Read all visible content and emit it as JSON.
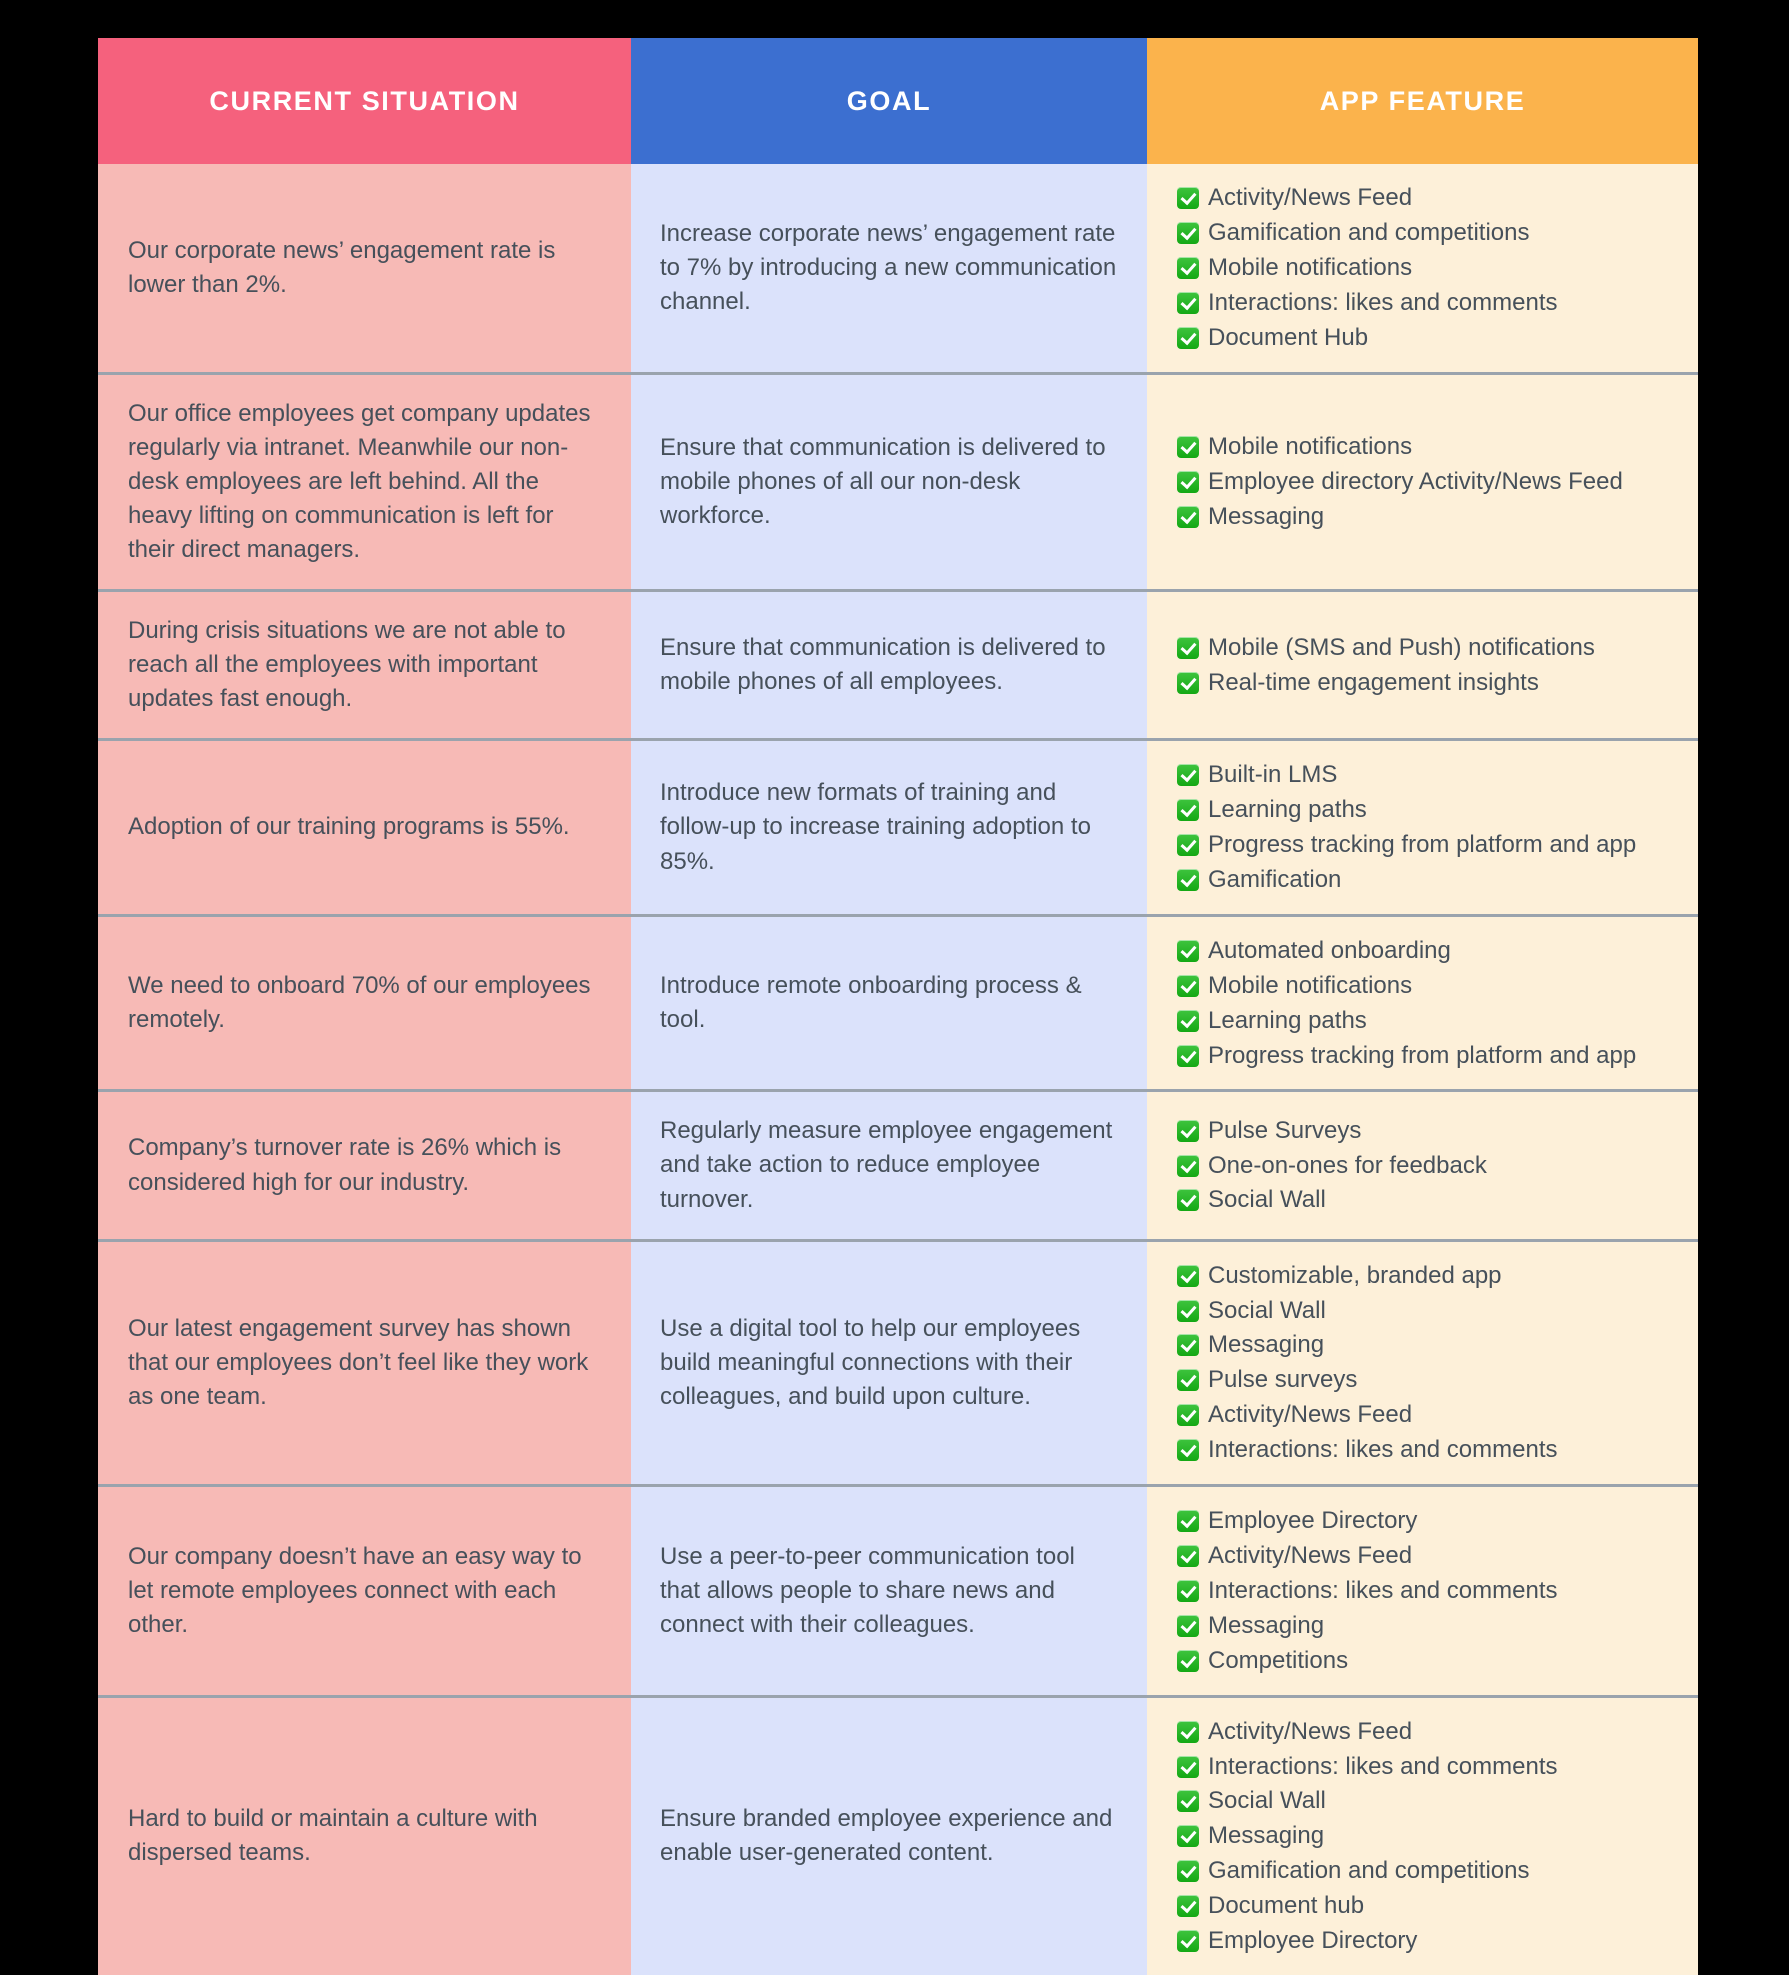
{
  "header": {
    "columns": [
      {
        "label": "CURRENT SITUATION",
        "color": "#f5617d"
      },
      {
        "label": "GOAL",
        "color": "#3c6fd0"
      },
      {
        "label": "APP FEATURE",
        "color": "#fbb34c"
      }
    ]
  },
  "colors": {
    "header_situation": "#f5617d",
    "header_goal": "#3c6fd0",
    "header_feature": "#fbb34c",
    "cell_situation": "#f7bab6",
    "cell_goal": "#dbe2fb",
    "cell_feature": "#fdf0d9",
    "text": "#46505a",
    "check_green": "#14a814",
    "divider": "#9aa3ad",
    "page_background": "#000000"
  },
  "icons": {
    "check": "white-heavy-check-mark-icon"
  },
  "rows": [
    {
      "situation": "Our corporate news’ engagement rate is lower than 2%.",
      "goal": "Increase corporate news’ engagement rate to 7% by introducing a new communication channel.",
      "features": [
        "Activity/News Feed",
        "Gamification and competitions",
        "Mobile notifications",
        "Interactions: likes and comments",
        "Document Hub"
      ]
    },
    {
      "situation": "Our office employees get company updates regularly via intranet. Meanwhile our non-desk employees are left behind. All the heavy lifting on communication is left for their direct managers.",
      "goal": "Ensure that communication is delivered to mobile phones of all our non-desk workforce.",
      "features": [
        "Mobile notifications",
        "Employee directory Activity/News Feed",
        "Messaging"
      ]
    },
    {
      "situation": "During crisis situations we are not able to reach all the employees with important updates fast enough.",
      "goal": "Ensure that communication is delivered to mobile phones of all employees.",
      "features": [
        "Mobile (SMS and Push) notifications",
        "Real-time engagement insights"
      ]
    },
    {
      "situation": "Adoption of our training programs is 55%.",
      "goal": "Introduce new formats of training and follow-up to increase training adoption to 85%.",
      "features": [
        "Built-in LMS",
        "Learning paths",
        "Progress tracking from platform and app",
        "Gamification"
      ]
    },
    {
      "situation": "We need to onboard 70% of our employees remotely.",
      "goal": "Introduce remote onboarding process & tool.",
      "features": [
        "Automated onboarding",
        "Mobile notifications",
        "Learning paths",
        "Progress tracking from platform and app"
      ]
    },
    {
      "situation": "Company’s turnover rate is 26% which is considered high for our industry.",
      "goal": "Regularly measure employee engagement and take action to reduce employee turnover.",
      "features": [
        "Pulse Surveys",
        "One-on-ones for feedback",
        "Social Wall"
      ]
    },
    {
      "situation": "Our latest engagement survey has shown that our employees don’t feel like they work as one team.",
      "goal": "Use a digital tool to help our employees build meaningful connections with their colleagues, and build upon culture.",
      "features": [
        "Customizable, branded app",
        "Social Wall",
        "Messaging",
        "Pulse surveys",
        "Activity/News Feed",
        "Interactions: likes and comments"
      ]
    },
    {
      "situation": "Our company doesn’t have an easy way to let remote employees connect with each other.",
      "goal": "Use a peer-to-peer communication tool that allows people to share news and connect with their colleagues.",
      "features": [
        "Employee Directory",
        "Activity/News Feed",
        "Interactions: likes and comments",
        "Messaging",
        "Competitions"
      ]
    },
    {
      "situation": "Hard to build or maintain a culture with dispersed teams.",
      "goal": "Ensure branded employee experience and enable user-generated content.",
      "features": [
        "Activity/News Feed",
        "Interactions: likes and comments",
        "Social Wall",
        "Messaging",
        "Gamification and competitions",
        "Document hub",
        "Employee Directory"
      ]
    }
  ]
}
